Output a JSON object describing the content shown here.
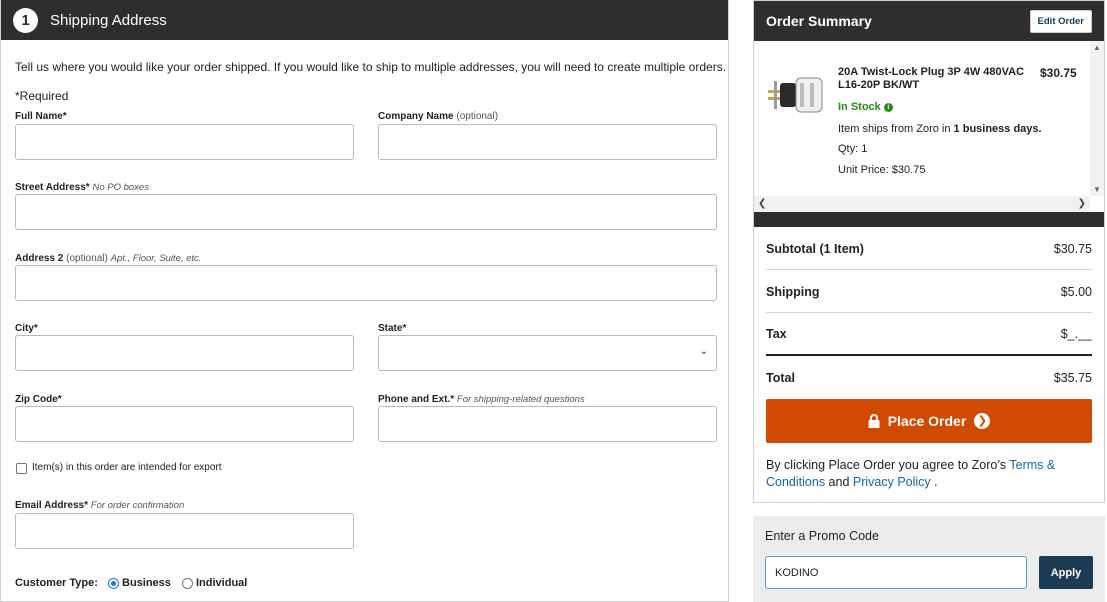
{
  "shipping": {
    "step_number": "1",
    "title": "Shipping Address",
    "intro": "Tell us where you would like your order shipped. If you would like to ship to multiple addresses, you will need to create multiple orders.",
    "required_note": "*Required",
    "full_name_label": "Full Name*",
    "company_label": "Company Name",
    "company_optional": "(optional)",
    "street_label": "Street Address*",
    "street_hint": "No PO boxes",
    "address2_label": "Address 2",
    "address2_optional": "(optional)",
    "address2_hint": "Apt., Floor, Suite, etc.",
    "city_label": "City*",
    "state_label": "State*",
    "zip_label": "Zip Code*",
    "phone_label": "Phone and Ext.*",
    "phone_hint": "For shipping-related questions",
    "export_label": "Item(s) in this order are intended for export",
    "email_label": "Email Address*",
    "email_hint": "For order confirmation",
    "customer_type_label": "Customer Type:",
    "customer_types": [
      "Business",
      "Individual"
    ],
    "customer_type_selected": "Business",
    "values": {
      "full_name": "",
      "company": "",
      "street": "",
      "address2": "",
      "city": "",
      "state": "",
      "zip": "",
      "phone": "",
      "email": ""
    }
  },
  "summary": {
    "title": "Order Summary",
    "edit_label": "Edit Order",
    "item": {
      "name": "20A Twist-Lock Plug 3P 4W 480VAC L16-20P BK/WT",
      "price": "$30.75",
      "stock": "In Stock",
      "ships_prefix": "Item ships from Zoro in ",
      "ships_days": "1 business days.",
      "qty": "Qty: 1",
      "unit_price": "Unit Price: $30.75"
    },
    "subtotal_label": "Subtotal (1 Item)",
    "subtotal_value": "$30.75",
    "shipping_label": "Shipping",
    "shipping_value": "$5.00",
    "tax_label": "Tax",
    "tax_value": "$_.__",
    "total_label": "Total",
    "total_value": "$35.75",
    "place_order_label": "Place Order",
    "terms_prefix": "By clicking Place Order you agree to Zoro’s ",
    "terms_link": "Terms & Conditions",
    "terms_and": " and ",
    "privacy_link": "Privacy Policy",
    "terms_suffix": " ."
  },
  "promo": {
    "label": "Enter a Promo Code",
    "value": "KODINO",
    "apply_label": "Apply"
  },
  "colors": {
    "header_dark": "#2e2e2e",
    "place_order": "#d04a02",
    "apply": "#1c3b55",
    "in_stock": "#2a8a19",
    "link": "#1764a5"
  }
}
